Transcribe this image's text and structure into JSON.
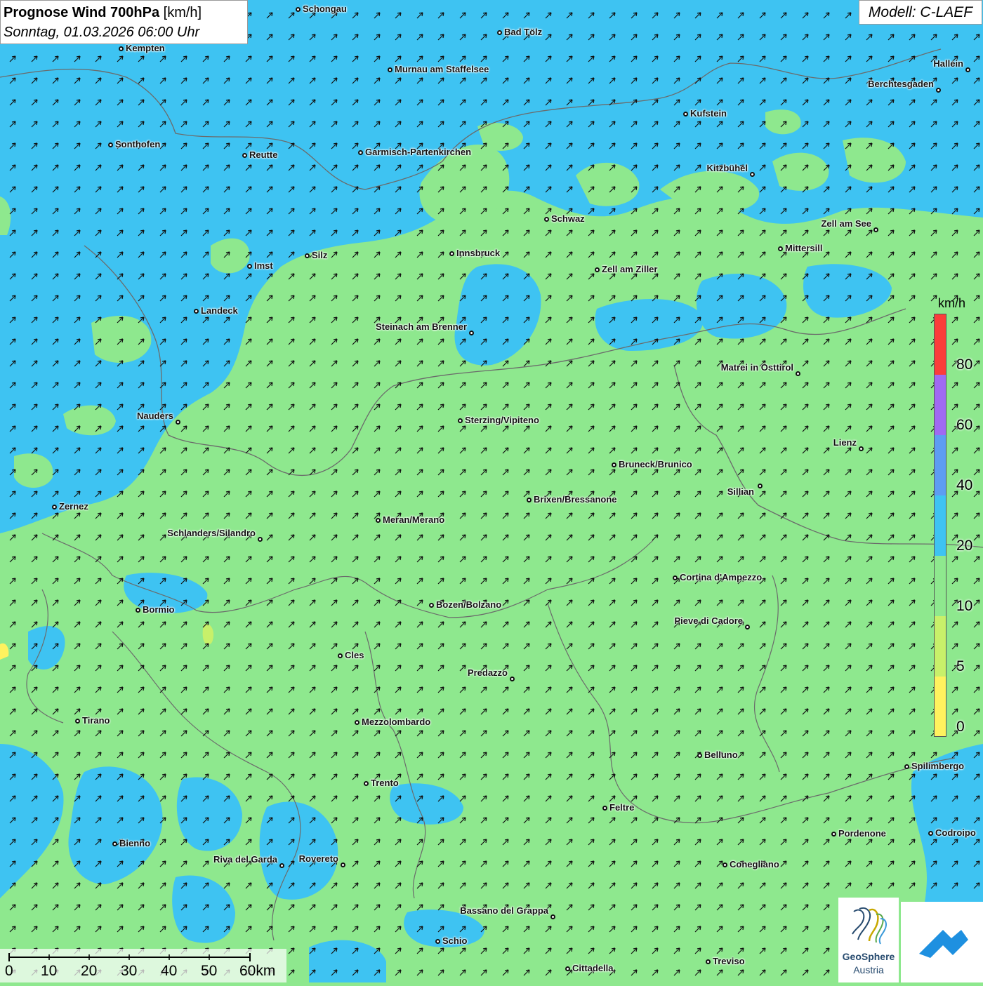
{
  "header": {
    "title_bold": "Prognose Wind 700hPa",
    "title_unit": "[km/h]",
    "datetime": "Sonntag, 01.03.2026 06:00 Uhr"
  },
  "model": "Modell: C-LAEF",
  "legend": {
    "unit": "km/h",
    "labels": [
      "80",
      "60",
      "40",
      "20",
      "10",
      "5",
      "0"
    ],
    "colors": [
      "#fb3d3a",
      "#a06af2",
      "#5d9df2",
      "#3ec3f2",
      "#8ee88e",
      "#c8f06a",
      "#fff25e",
      "#fb3d3a"
    ]
  },
  "scale": {
    "labels": [
      "0",
      "10",
      "20",
      "30",
      "40",
      "50",
      "60km"
    ]
  },
  "logo": {
    "name": "GeoSphere",
    "sub": "Austria"
  },
  "cities": [
    {
      "name": "Schongau"
    },
    {
      "name": "Bad Tölz"
    },
    {
      "name": "Kempten"
    },
    {
      "name": "Murnau am Staffelsee"
    },
    {
      "name": "Hallein"
    },
    {
      "name": "Berchtesgaden"
    },
    {
      "name": "Kufstein"
    },
    {
      "name": "Sonthofen"
    },
    {
      "name": "Reutte"
    },
    {
      "name": "Garmisch-Partenkirchen"
    },
    {
      "name": "Kitzbühel"
    },
    {
      "name": "Schwaz"
    },
    {
      "name": "Zell am See"
    },
    {
      "name": "Mittersill"
    },
    {
      "name": "Innsbruck"
    },
    {
      "name": "Silz"
    },
    {
      "name": "Imst"
    },
    {
      "name": "Zell am Ziller"
    },
    {
      "name": "Landeck"
    },
    {
      "name": "Steinach am Brenner"
    },
    {
      "name": "Matrei in Osttirol"
    },
    {
      "name": "Nauders"
    },
    {
      "name": "Sterzing/Vipiteno"
    },
    {
      "name": "Lienz"
    },
    {
      "name": "Bruneck/Brunico"
    },
    {
      "name": "Sillian"
    },
    {
      "name": "Zernez"
    },
    {
      "name": "Brixen/Bressanone"
    },
    {
      "name": "Meran/Merano"
    },
    {
      "name": "Schlanders/Silandro"
    },
    {
      "name": "Cortina d'Ampezzo"
    },
    {
      "name": "Bozen/Bolzano"
    },
    {
      "name": "Bormio"
    },
    {
      "name": "Pieve di Cadore"
    },
    {
      "name": "Cles"
    },
    {
      "name": "Predazzo"
    },
    {
      "name": "Tirano"
    },
    {
      "name": "Mezzolombardo"
    },
    {
      "name": "Belluno"
    },
    {
      "name": "Spilimbergo"
    },
    {
      "name": "Trento"
    },
    {
      "name": "Feltre"
    },
    {
      "name": "Pordenone"
    },
    {
      "name": "Codroipo"
    },
    {
      "name": "Bienno"
    },
    {
      "name": "Riva del Garda"
    },
    {
      "name": "Rovereto"
    },
    {
      "name": "Conegliano"
    },
    {
      "name": "Bassano del Grappa"
    },
    {
      "name": "Schio"
    },
    {
      "name": "Treviso"
    },
    {
      "name": "Cittadella"
    }
  ]
}
